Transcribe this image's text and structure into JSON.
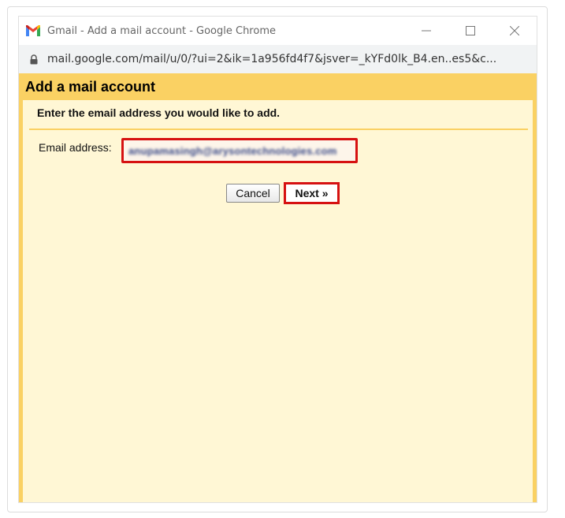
{
  "window": {
    "title": "Gmail - Add a mail account - Google Chrome",
    "url": "mail.google.com/mail/u/0/?ui=2&ik=1a956fd4f7&jsver=_kYFd0lk_B4.en..es5&c..."
  },
  "dialog": {
    "heading": "Add a mail account",
    "prompt": "Enter the email address you would like to add.",
    "email_label": "Email address:",
    "email_value": "anupamasingh@arysontechnologies.com",
    "cancel_label": "Cancel",
    "next_label": "Next »"
  },
  "colors": {
    "header": "#fad163",
    "panel": "#fff7d5",
    "highlight": "#d61111"
  },
  "icons": [
    "gmail-logo-icon",
    "minimize-icon",
    "maximize-icon",
    "close-icon",
    "lock-icon"
  ]
}
